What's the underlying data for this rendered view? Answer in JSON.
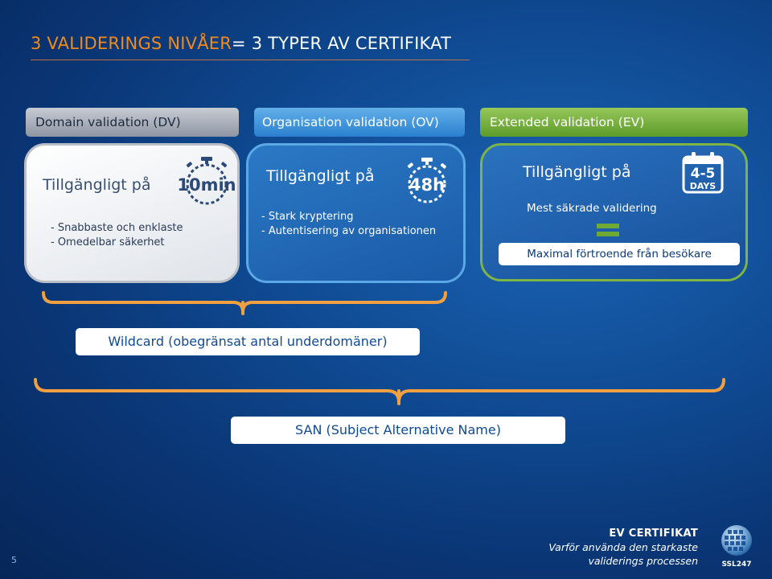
{
  "slide": {
    "title_accent": "3 VALIDERINGS NIVÅER",
    "title_rest": "= 3 TYPER AV CERTIFIKAT",
    "page_number": "5"
  },
  "columns": {
    "dv": {
      "header": "Domain validation (DV)",
      "available": "Tillgängligt på",
      "badge": "10min",
      "bullets": [
        "-  Snabbaste och enklaste",
        "-  Omedelbar säkerhet"
      ]
    },
    "ov": {
      "header": "Organisation validation (OV)",
      "available": "Tillgängligt på",
      "badge": "48h",
      "bullets": [
        "-  Stark kryptering",
        "-  Autentisering av organisationen"
      ]
    },
    "ev": {
      "header": "Extended validation (EV)",
      "available": "Tillgängligt på",
      "badge_top": "4-5",
      "badge_bottom": "DAYS",
      "secure": "Mest säkrade validering",
      "trust": "Maximal förtroende från besökare"
    }
  },
  "wildcard": {
    "label": "Wildcard (obegränsat antal underdomäner)"
  },
  "san": {
    "label": "SAN (Subject Alternative Name)"
  },
  "footer": {
    "line1": "EV CERTIFIKAT",
    "line2": "Varför använda den starkaste",
    "line3": "validerings processen",
    "logo_text": "SSL247"
  },
  "colors": {
    "accent": "#f08a1c",
    "dv": "#b9bec7",
    "ov": "#3f97df",
    "ev": "#7db443",
    "brace": "#f0a040"
  },
  "icons": [
    "stopwatch-icon",
    "calendar-icon",
    "equals-icon",
    "ssl247-globe-icon"
  ]
}
